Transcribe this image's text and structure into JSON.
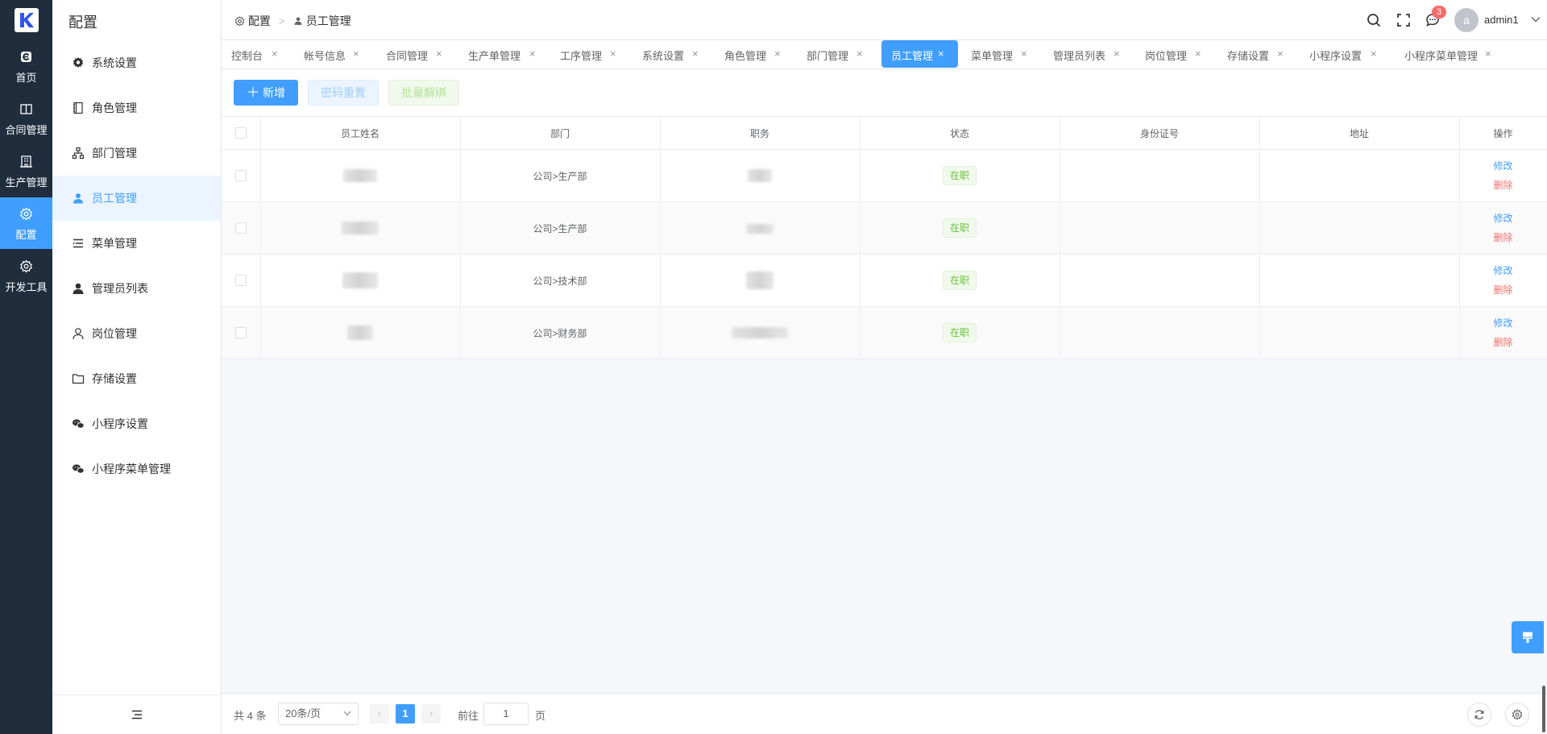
{
  "rail": {
    "items": [
      {
        "label": "首页",
        "icon": "home-icon"
      },
      {
        "label": "合同管理",
        "icon": "book-icon"
      },
      {
        "label": "生产管理",
        "icon": "building-icon"
      },
      {
        "label": "配置",
        "icon": "gear-icon"
      },
      {
        "label": "开发工具",
        "icon": "gear-icon"
      }
    ]
  },
  "submenu": {
    "title": "配置",
    "items": [
      {
        "label": "系统设置",
        "icon": "gear-solid-icon"
      },
      {
        "label": "角色管理",
        "icon": "notebook-icon"
      },
      {
        "label": "部门管理",
        "icon": "org-chart-icon"
      },
      {
        "label": "员工管理",
        "icon": "user-icon"
      },
      {
        "label": "菜单管理",
        "icon": "menu-list-icon"
      },
      {
        "label": "管理员列表",
        "icon": "user-solid-icon"
      },
      {
        "label": "岗位管理",
        "icon": "user-outline-icon"
      },
      {
        "label": "存储设置",
        "icon": "folder-icon"
      },
      {
        "label": "小程序设置",
        "icon": "wechat-icon"
      },
      {
        "label": "小程序菜单管理",
        "icon": "wechat-icon"
      }
    ]
  },
  "breadcrumb": {
    "root": "配置",
    "current": "员工管理"
  },
  "header": {
    "notification_count": "3",
    "avatar_letter": "a",
    "username": "admin1"
  },
  "tabs": [
    "控制台",
    "帐号信息",
    "合同管理",
    "生产单管理",
    "工序管理",
    "系统设置",
    "角色管理",
    "部门管理",
    "员工管理",
    "菜单管理",
    "管理员列表",
    "岗位管理",
    "存储设置",
    "小程序设置",
    "小程序菜单管理"
  ],
  "tab_close": "×",
  "toolbar": {
    "add_label": "新增",
    "reset_password_label": "密码重置",
    "batch_unbind_label": "批量解绑"
  },
  "table": {
    "columns": [
      "员工姓名",
      "部门",
      "职务",
      "状态",
      "身份证号",
      "地址",
      "操作"
    ],
    "rows": [
      {
        "department": "公司>生产部",
        "status": "在职"
      },
      {
        "department": "公司>生产部",
        "status": "在职"
      },
      {
        "department": "公司>技术部",
        "status": "在职"
      },
      {
        "department": "公司>财务部",
        "status": "在职"
      }
    ],
    "edit_label": "修改",
    "delete_label": "删除"
  },
  "pagination": {
    "total": "共 4 条",
    "page_size": "20条/页",
    "current": "1",
    "goto_label": "前往",
    "goto_value": "1",
    "page_unit": "页",
    "prev": "‹",
    "next": "›"
  },
  "colors": {
    "primary": "#409eff",
    "sidebar_bg": "#1f2d3d",
    "success": "#67c23a",
    "danger": "#f56c6c"
  }
}
